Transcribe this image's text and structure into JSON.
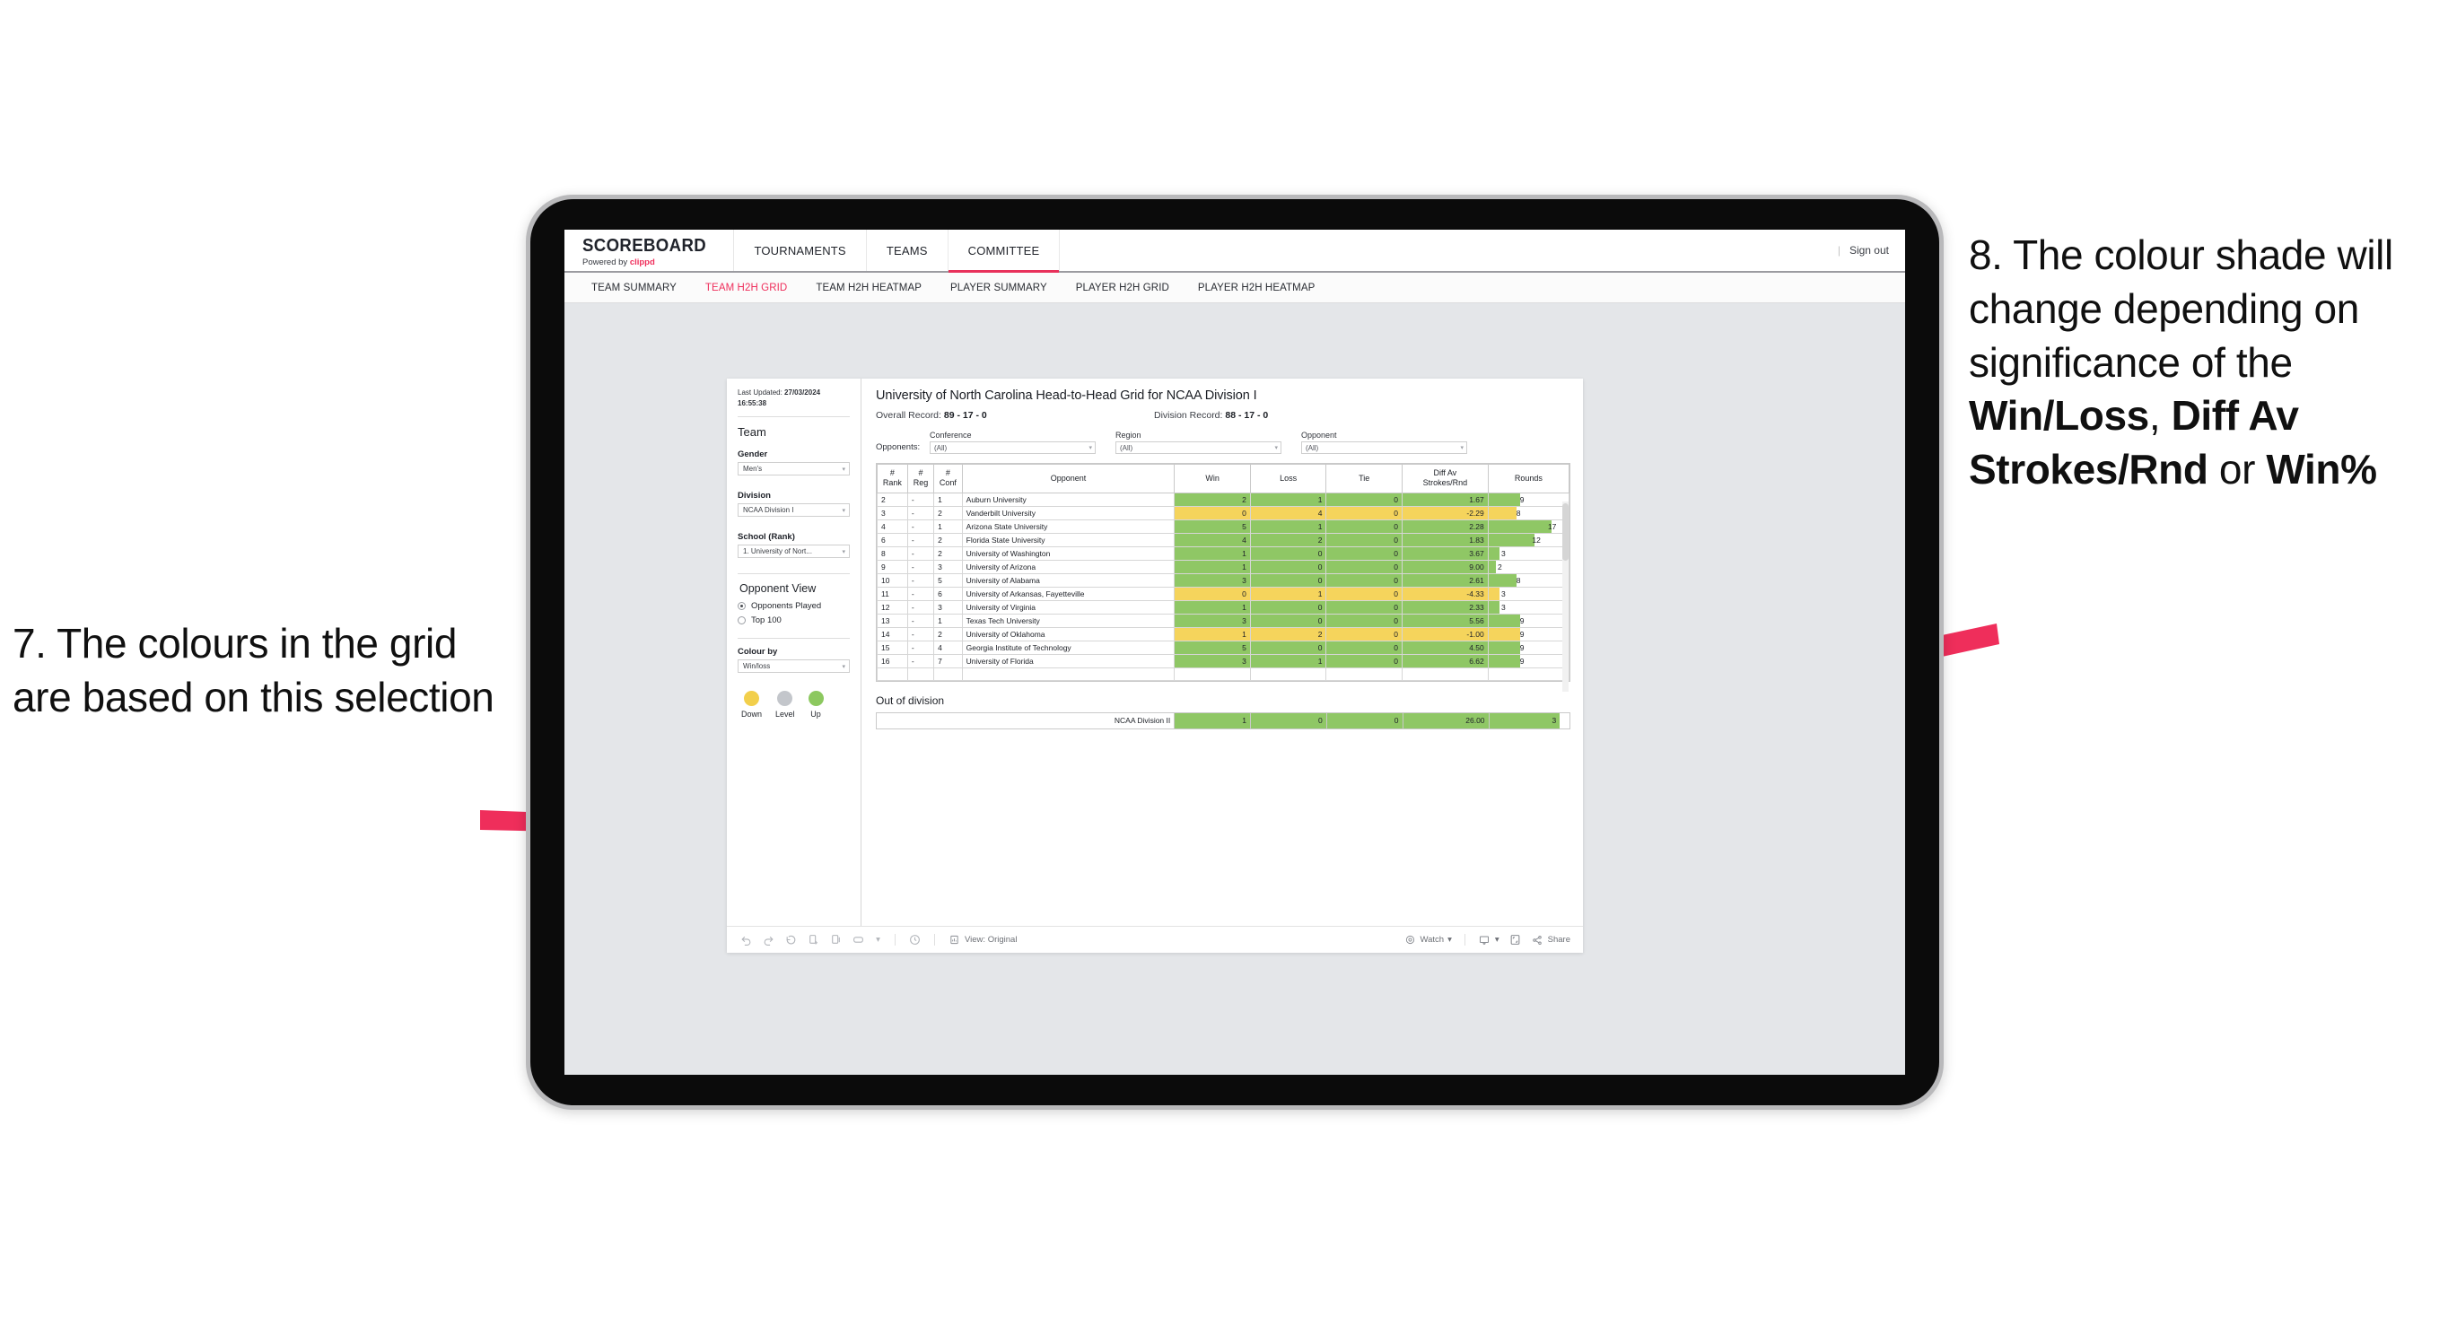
{
  "annotations": {
    "left": "7. The colours in the grid are based on this selection",
    "right_pre": "8. The colour shade will change depending on significance of the ",
    "right_b1": "Win/Loss",
    "right_mid1": ", ",
    "right_b2": "Diff Av Strokes/Rnd",
    "right_mid2": " or ",
    "right_b3": "Win%",
    "arrow_color": "#ef2e5b"
  },
  "topbar": {
    "brand_title": "SCOREBOARD",
    "brand_sub_pre": "Powered by ",
    "brand_sub_brand": "clippd",
    "nav": [
      {
        "label": "TOURNAMENTS",
        "active": false
      },
      {
        "label": "TEAMS",
        "active": false
      },
      {
        "label": "COMMITTEE",
        "active": true
      }
    ],
    "signout_divider": "|",
    "signout": "Sign out"
  },
  "subnav": {
    "items": [
      {
        "label": "TEAM SUMMARY",
        "active": false
      },
      {
        "label": "TEAM H2H GRID",
        "active": true
      },
      {
        "label": "TEAM H2H HEATMAP",
        "active": false
      },
      {
        "label": "PLAYER SUMMARY",
        "active": false
      },
      {
        "label": "PLAYER H2H GRID",
        "active": false
      },
      {
        "label": "PLAYER H2H HEATMAP",
        "active": false
      }
    ]
  },
  "sidebar": {
    "last_updated_label": "Last Updated: ",
    "last_updated_value": "27/03/2024 16:55:38",
    "team_heading": "Team",
    "gender_label": "Gender",
    "gender_value": "Men's",
    "division_label": "Division",
    "division_value": "NCAA Division I",
    "school_label": "School (Rank)",
    "school_value": "1. University of Nort...",
    "opponent_view_heading": "Opponent View",
    "opponent_view_options": [
      {
        "label": "Opponents Played",
        "selected": true
      },
      {
        "label": "Top 100",
        "selected": false
      }
    ],
    "colour_by_label": "Colour by",
    "colour_by_value": "Win/loss",
    "legend": [
      {
        "label": "Down",
        "color": "#f2cf4b"
      },
      {
        "label": "Level",
        "color": "#c3c6cb"
      },
      {
        "label": "Up",
        "color": "#8cc85f"
      }
    ]
  },
  "main": {
    "title": "University of North Carolina Head-to-Head Grid for NCAA Division I",
    "overall_record_label": "Overall Record: ",
    "overall_record_value": "89 - 17 - 0",
    "division_record_label": "Division Record: ",
    "division_record_value": "88 - 17 - 0",
    "opponents_label": "Opponents:",
    "filters": [
      {
        "label": "Conference",
        "value": "(All)"
      },
      {
        "label": "Region",
        "value": "(All)"
      },
      {
        "label": "Opponent",
        "value": "(All)"
      }
    ],
    "out_of_division_title": "Out of division",
    "out_of_division_row": {
      "name": "NCAA Division II",
      "win": "1",
      "loss": "0",
      "tie": "0",
      "diff": "26.00",
      "rounds": "3",
      "color": "green",
      "bar_pct": 88
    }
  },
  "chart_data": {
    "type": "table",
    "title": "University of North Carolina Head-to-Head Grid for NCAA Division I",
    "columns": [
      "# Rank",
      "# Reg",
      "# Conf",
      "Opponent",
      "Win",
      "Loss",
      "Tie",
      "Diff Av Strokes/Rnd",
      "Rounds"
    ],
    "column_headers_multiline": [
      [
        "#",
        "Rank"
      ],
      [
        "#",
        "Reg"
      ],
      [
        "#",
        "Conf"
      ],
      [
        "",
        "Opponent"
      ],
      [
        "Win",
        ""
      ],
      [
        "Loss",
        ""
      ],
      [
        "Tie",
        ""
      ],
      [
        "Diff Av",
        "Strokes/Rnd"
      ],
      [
        "Rounds",
        ""
      ]
    ],
    "rows": [
      {
        "rank": "2",
        "reg": "-",
        "conf": "1",
        "opponent": "Auburn University",
        "win": "2",
        "loss": "1",
        "tie": "0",
        "diff": "1.67",
        "rounds": "9",
        "color": "green",
        "bar_pct": 40
      },
      {
        "rank": "3",
        "reg": "-",
        "conf": "2",
        "opponent": "Vanderbilt University",
        "win": "0",
        "loss": "4",
        "tie": "0",
        "diff": "-2.29",
        "rounds": "8",
        "color": "yellow",
        "bar_pct": 35
      },
      {
        "rank": "4",
        "reg": "-",
        "conf": "1",
        "opponent": "Arizona State University",
        "win": "5",
        "loss": "1",
        "tie": "0",
        "diff": "2.28",
        "rounds": "17",
        "color": "green",
        "bar_pct": 79
      },
      {
        "rank": "6",
        "reg": "-",
        "conf": "2",
        "opponent": "Florida State University",
        "win": "4",
        "loss": "2",
        "tie": "0",
        "diff": "1.83",
        "rounds": "12",
        "color": "green",
        "bar_pct": 57
      },
      {
        "rank": "8",
        "reg": "-",
        "conf": "2",
        "opponent": "University of Washington",
        "win": "1",
        "loss": "0",
        "tie": "0",
        "diff": "3.67",
        "rounds": "3",
        "color": "green",
        "bar_pct": 14
      },
      {
        "rank": "9",
        "reg": "-",
        "conf": "3",
        "opponent": "University of Arizona",
        "win": "1",
        "loss": "0",
        "tie": "0",
        "diff": "9.00",
        "rounds": "2",
        "color": "green",
        "bar_pct": 9
      },
      {
        "rank": "10",
        "reg": "-",
        "conf": "5",
        "opponent": "University of Alabama",
        "win": "3",
        "loss": "0",
        "tie": "0",
        "diff": "2.61",
        "rounds": "8",
        "color": "green",
        "bar_pct": 35
      },
      {
        "rank": "11",
        "reg": "-",
        "conf": "6",
        "opponent": "University of Arkansas, Fayetteville",
        "win": "0",
        "loss": "1",
        "tie": "0",
        "diff": "-4.33",
        "rounds": "3",
        "color": "yellow",
        "bar_pct": 14
      },
      {
        "rank": "12",
        "reg": "-",
        "conf": "3",
        "opponent": "University of Virginia",
        "win": "1",
        "loss": "0",
        "tie": "0",
        "diff": "2.33",
        "rounds": "3",
        "color": "green",
        "bar_pct": 14
      },
      {
        "rank": "13",
        "reg": "-",
        "conf": "1",
        "opponent": "Texas Tech University",
        "win": "3",
        "loss": "0",
        "tie": "0",
        "diff": "5.56",
        "rounds": "9",
        "color": "green",
        "bar_pct": 40
      },
      {
        "rank": "14",
        "reg": "-",
        "conf": "2",
        "opponent": "University of Oklahoma",
        "win": "1",
        "loss": "2",
        "tie": "0",
        "diff": "-1.00",
        "rounds": "9",
        "color": "yellow",
        "bar_pct": 40
      },
      {
        "rank": "15",
        "reg": "-",
        "conf": "4",
        "opponent": "Georgia Institute of Technology",
        "win": "5",
        "loss": "0",
        "tie": "0",
        "diff": "4.50",
        "rounds": "9",
        "color": "green",
        "bar_pct": 40
      },
      {
        "rank": "16",
        "reg": "-",
        "conf": "7",
        "opponent": "University of Florida",
        "win": "3",
        "loss": "1",
        "tie": "0",
        "diff": "6.62",
        "rounds": "9",
        "color": "green",
        "bar_pct": 40
      }
    ],
    "colors": {
      "green": "#8fc765",
      "yellow": "#f5d45c"
    }
  },
  "toolbar": {
    "view_label": "View: Original",
    "watch_label": "Watch",
    "share_label": "Share",
    "caret": "▾"
  }
}
